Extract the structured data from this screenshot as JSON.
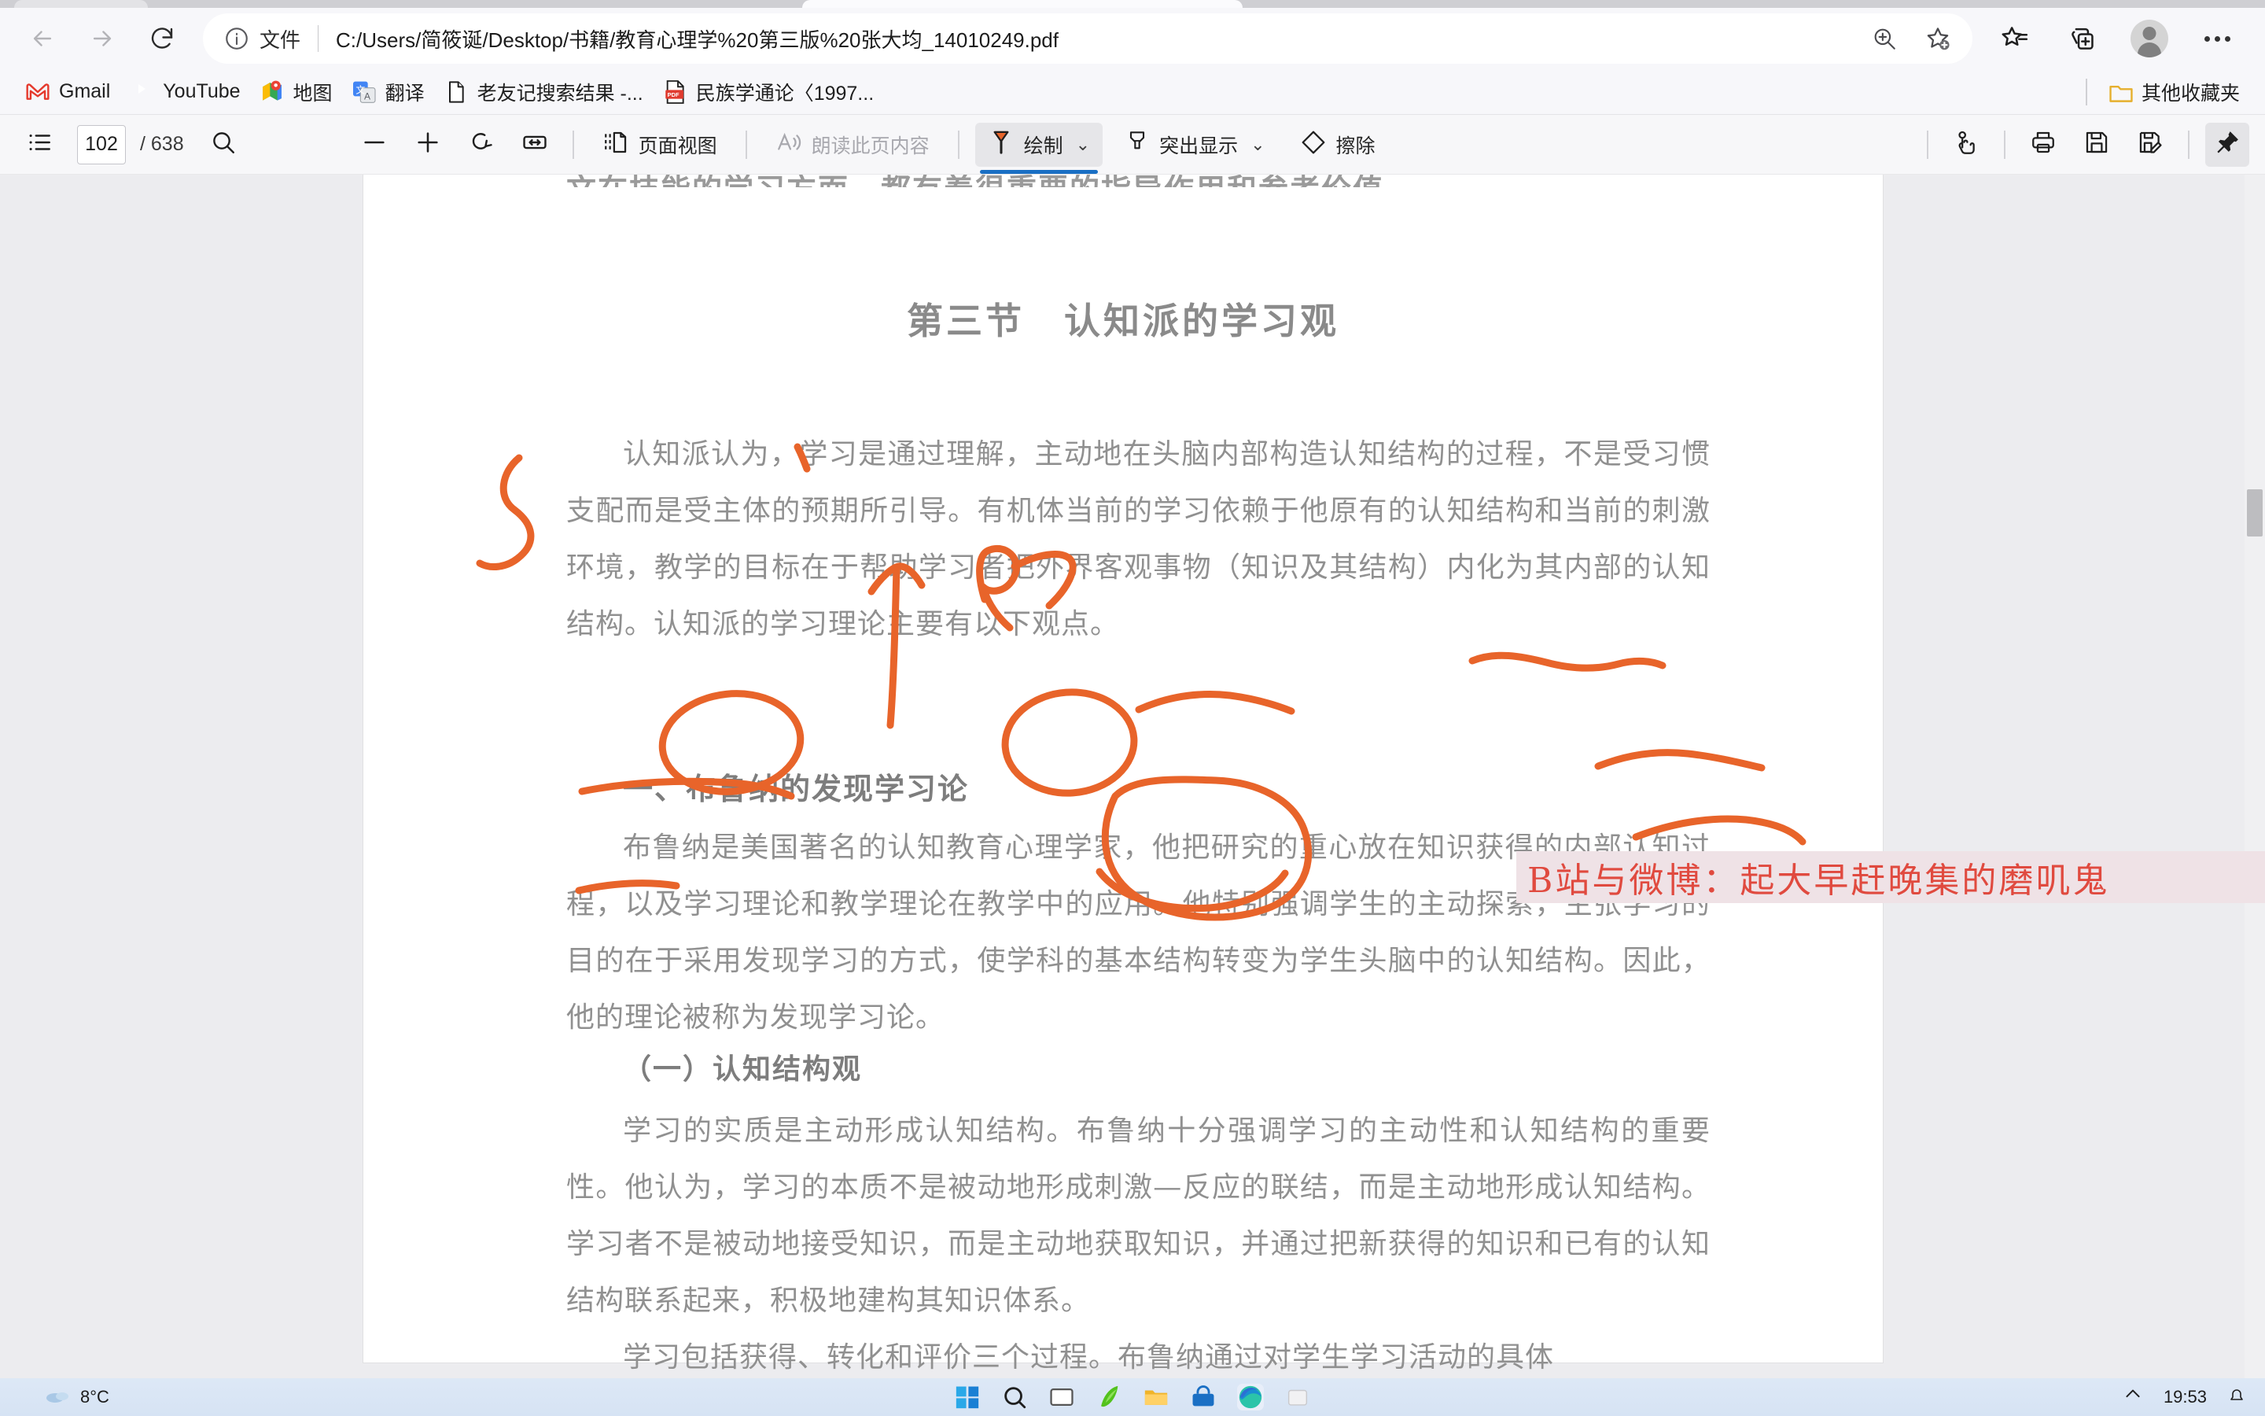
{
  "browser": {
    "nav": {
      "back": "back-arrow",
      "forward": "forward-arrow",
      "reload": "reload-icon"
    },
    "omnibox": {
      "scheme_label": "文件",
      "url": "C:/Users/简筱诞/Desktop/书籍/教育心理学%20第三版%20张大均_14010249.pdf",
      "info_icon": "info-icon",
      "zoom_icon": "zoom-in-icon",
      "favorite_icon": "add-favorite-icon"
    },
    "toolbar_right": {
      "favorites": "favorites-icon",
      "collections": "collections-icon",
      "profile": "profile-avatar",
      "settings_more": "more-options-icon"
    },
    "bookmarks": [
      {
        "label": "Gmail",
        "icon": "gmail-icon"
      },
      {
        "label": "YouTube",
        "icon": "youtube-icon"
      },
      {
        "label": "地图",
        "icon": "google-maps-icon"
      },
      {
        "label": "翻译",
        "icon": "google-translate-icon"
      },
      {
        "label": "老友记搜索结果 -...",
        "icon": "document-icon"
      },
      {
        "label": "民族学通论〈1997...",
        "icon": "pdf-icon"
      }
    ],
    "bookmarks_other": {
      "label": "其他收藏夹",
      "icon": "folder-icon"
    }
  },
  "pdf_toolbar": {
    "sidebar_toggle": "page-list-icon",
    "current_page": "102",
    "page_total": "/ 638",
    "search": "search-icon",
    "zoom_out": "zoom-out-icon",
    "zoom_in": "zoom-in-icon",
    "rotate": "rotate-icon",
    "fit_width": "fit-to-width-icon",
    "page_view": {
      "label": "页面视图",
      "icon": "page-view-icon"
    },
    "read_aloud": {
      "label": "朗读此页内容",
      "icon": "read-aloud-icon"
    },
    "draw": {
      "label": "绘制",
      "icon": "draw-pen-icon",
      "active": true,
      "accent": "#1a6fc4",
      "pen_color": "#e8642a"
    },
    "highlight": {
      "label": "突出显示",
      "icon": "highlighter-icon"
    },
    "erase": {
      "label": "擦除",
      "icon": "eraser-icon"
    },
    "touch": "touch-hand-icon",
    "print": "print-icon",
    "save": "save-icon",
    "save_as": "save-as-icon",
    "pin": "pin-icon"
  },
  "document": {
    "cut_line": "文在技能的学习方面，都有着很重要的指导作用和参考价值。",
    "title": "第三节　认知派的学习观",
    "paragraph_1": "认知派认为，学习是通过理解，主动地在头脑内部构造认知结构的过程，不是受习惯支配而是受主体的预期所引导。有机体当前的学习依赖于他原有的认知结构和当前的刺激环境，教学的目标在于帮助学习者把外界客观事物（知识及其结构）内化为其内部的认知结构。认知派的学习理论主要有以下观点。",
    "heading_1": "一、布鲁纳的发现学习论",
    "paragraph_2": "布鲁纳是美国著名的认知教育心理学家，他把研究的重心放在知识获得的内部认知过程，以及学习理论和教学理论在教学中的应用。他特别强调学生的主动探索，主张学习的目的在于采用发现学习的方式，使学科的基本结构转变为学生头脑中的认知结构。因此，他的理论被称为发现学习论。",
    "heading_2": "（一）认知结构观",
    "paragraph_3": "学习的实质是主动形成认知结构。布鲁纳十分强调学习的主动性和认知结构的重要性。他认为，学习的本质不是被动地形成刺激—反应的联结，而是主动地形成认知结构。学习者不是被动地接受知识，而是主动地获取知识，并通过把新获得的知识和已有的认知结构联系起来，积极地建构其知识体系。",
    "paragraph_4": "学习包括获得、转化和评价三个过程。布鲁纳通过对学生学习活动的具体",
    "watermark": "B站与微博：起大早赶晚集的磨叽鬼",
    "ink_color": "#e8642a"
  },
  "taskbar": {
    "weather": {
      "temp": "8°C",
      "icon": "weather-cloud-icon"
    },
    "items": [
      {
        "name": "start-button",
        "icon": "windows-start-icon"
      },
      {
        "name": "search-button",
        "icon": "search-icon"
      },
      {
        "name": "task-view-button",
        "icon": "task-view-icon"
      },
      {
        "name": "wps-office",
        "icon": "wps-icon"
      },
      {
        "name": "file-explorer",
        "icon": "folder-icon"
      },
      {
        "name": "microsoft-store",
        "icon": "store-icon"
      },
      {
        "name": "microsoft-edge",
        "icon": "edge-icon"
      },
      {
        "name": "app-extra",
        "icon": "app-icon"
      }
    ],
    "clock": "19:53",
    "tray": "system-tray-icon"
  }
}
